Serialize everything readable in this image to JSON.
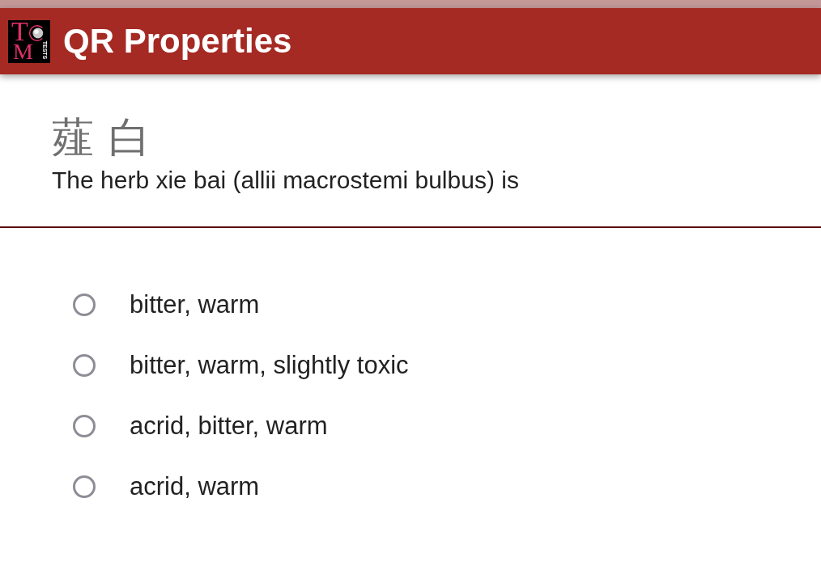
{
  "app_bar": {
    "logo": {
      "mark_top": "T",
      "mark_bottom": "M",
      "caption": "TESTS"
    },
    "title": "QR Properties"
  },
  "question": {
    "chinese_name": "薤 白",
    "prompt": "The herb xie bai (allii macrostemi bulbus) is"
  },
  "options": [
    {
      "label": "bitter, warm",
      "selected": false
    },
    {
      "label": "bitter, warm, slightly toxic",
      "selected": false
    },
    {
      "label": "acrid, bitter, warm",
      "selected": false
    },
    {
      "label": "acrid, warm",
      "selected": false
    }
  ]
}
